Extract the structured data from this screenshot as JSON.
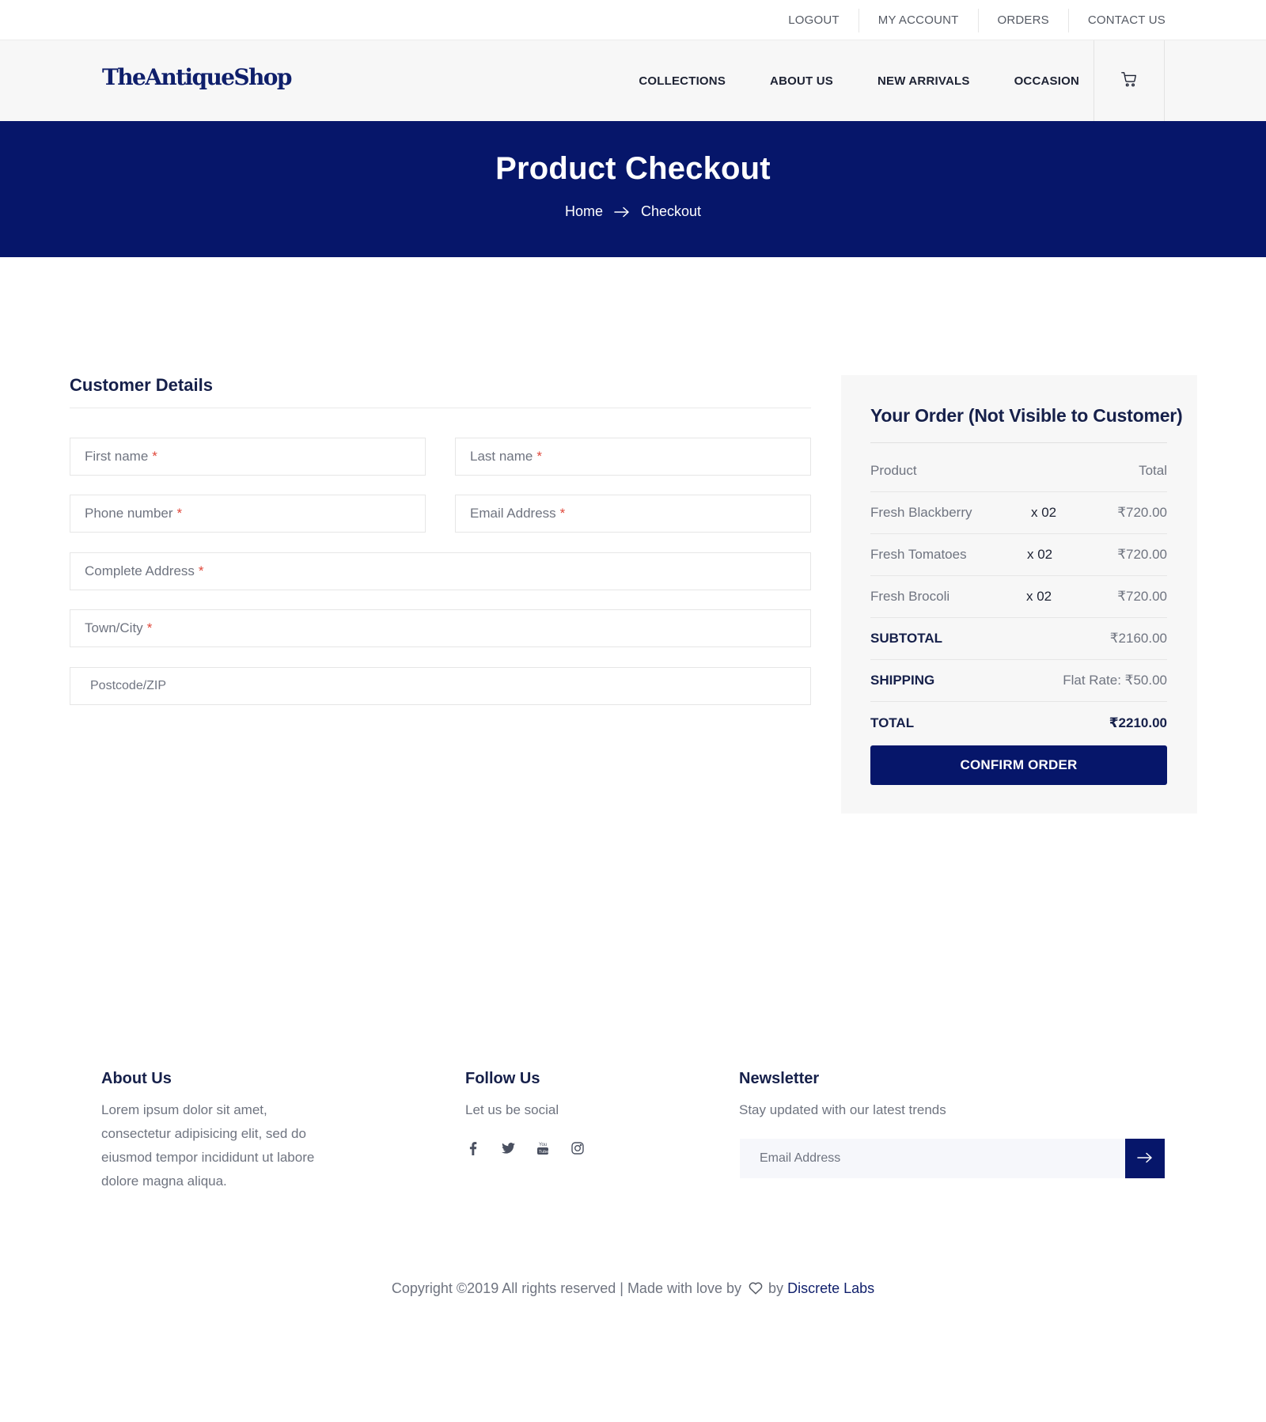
{
  "topbar": {
    "links": [
      "LOGOUT",
      "MY ACCOUNT",
      "ORDERS",
      "CONTACT US"
    ]
  },
  "header": {
    "logo": "TheAntiqueShop",
    "nav": [
      "COLLECTIONS",
      "ABOUT US",
      "NEW ARRIVALS",
      "OCCASION"
    ],
    "cart_icon": "cart-icon"
  },
  "hero": {
    "title": "Product Checkout",
    "breadcrumb": [
      "Home",
      "Checkout"
    ],
    "background": "#06166a"
  },
  "customer": {
    "title": "Customer Details",
    "fields": {
      "first_name": "First name",
      "last_name": "Last name",
      "phone": "Phone number",
      "email": "Email Address",
      "address": "Complete Address",
      "city": "Town/City",
      "postcode": "Postcode/ZIP"
    },
    "required_mark": "*"
  },
  "order": {
    "title": "Your Order (Not Visible to Customer)",
    "col_product": "Product",
    "col_total": "Total",
    "items": [
      {
        "name": "Fresh Blackberry",
        "qty": "x 02",
        "price": "₹720.00"
      },
      {
        "name": "Fresh Tomatoes",
        "qty": "x 02",
        "price": "₹720.00"
      },
      {
        "name": "Fresh Brocoli",
        "qty": "x 02",
        "price": "₹720.00"
      }
    ],
    "subtotal_label": "SUBTOTAL",
    "subtotal_value": "₹2160.00",
    "shipping_label": "SHIPPING",
    "shipping_value": "Flat Rate: ₹50.00",
    "total_label": "TOTAL",
    "total_value": "₹2210.00",
    "confirm_label": "CONFIRM ORDER"
  },
  "footer": {
    "about_title": "About Us",
    "about_text": "Lorem ipsum dolor sit amet, consectetur adipisicing elit, sed do eiusmod tempor incididunt ut labore dolore magna aliqua.",
    "follow_title": "Follow Us",
    "follow_text": "Let us be social",
    "social_icons": [
      "facebook-icon",
      "twitter-icon",
      "youtube-icon",
      "instagram-icon"
    ],
    "news_title": "Newsletter",
    "news_text": "Stay updated with our latest trends",
    "news_placeholder": "Email Address",
    "copyright_text": "Copyright ©2019 All rights reserved | Made with love by",
    "copyright_by": "by",
    "copyright_brand": "Discrete Labs"
  },
  "colors": {
    "brand_navy": "#06166a",
    "required_red": "#e0473a",
    "panel_bg": "#f7f7f7"
  }
}
